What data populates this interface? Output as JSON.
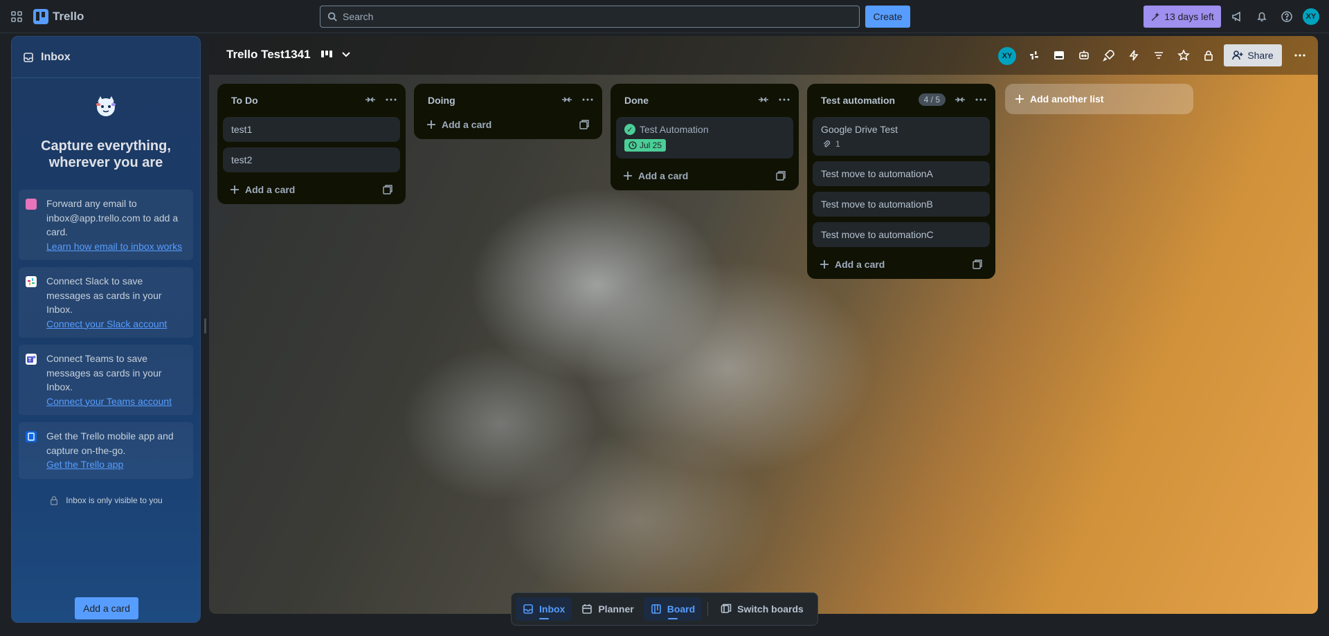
{
  "topbar": {
    "app_name": "Trello",
    "search_placeholder": "Search",
    "create_label": "Create",
    "trial_label": "13 days left",
    "avatar_initials": "XY"
  },
  "inbox": {
    "title": "Inbox",
    "headline": "Capture everything, wherever you are",
    "tips": [
      {
        "text": "Forward any email to inbox@app.trello.com to add a card.",
        "link": "Learn how email to inbox works",
        "icon": "email-icon"
      },
      {
        "text": "Connect Slack to save messages as cards in your Inbox.",
        "link": "Connect your Slack account",
        "icon": "slack-icon"
      },
      {
        "text": "Connect Teams to save messages as cards in your Inbox.",
        "link": "Connect your Teams account",
        "icon": "teams-icon"
      },
      {
        "text": "Get the Trello mobile app and capture on-the-go.",
        "link": "Get the Trello app",
        "icon": "mobile-app-icon"
      }
    ],
    "privacy_note": "Inbox is only visible to you",
    "add_card_label": "Add a card"
  },
  "board": {
    "title": "Trello Test1341",
    "avatar_initials": "XY",
    "share_label": "Share",
    "add_list_label": "Add another list",
    "lists": [
      {
        "title": "To Do",
        "cards": [
          "test1",
          "test2"
        ],
        "add_label": "Add a card"
      },
      {
        "title": "Doing",
        "cards": [],
        "add_label": "Add a card"
      },
      {
        "title": "Done",
        "cards": [
          {
            "title": "Test Automation",
            "due": "Jul 25",
            "complete": true
          }
        ],
        "add_label": "Add a card"
      },
      {
        "title": "Test automation",
        "count": "4 / 5",
        "cards": [
          {
            "title": "Google Drive Test",
            "attachments": "1"
          },
          {
            "title": "Test move to automationA"
          },
          {
            "title": "Test move to automationB"
          },
          {
            "title": "Test move to automationC"
          }
        ],
        "add_label": "Add a card"
      }
    ]
  },
  "bottom_nav": {
    "inbox": "Inbox",
    "planner": "Planner",
    "board": "Board",
    "switch": "Switch boards"
  },
  "colors": {
    "accent": "#579dff",
    "trial": "#9f8fef",
    "due_complete": "#4bce97",
    "avatar": "#00a3bf"
  }
}
